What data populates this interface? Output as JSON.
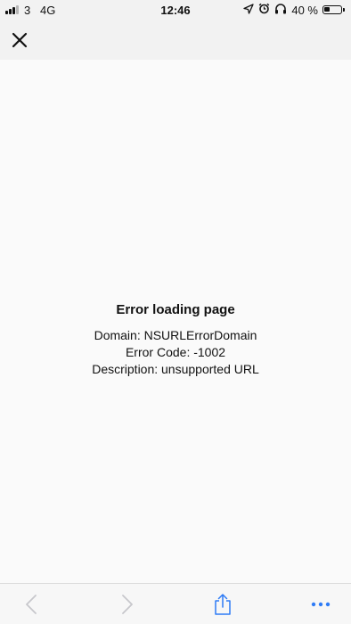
{
  "status_bar": {
    "carrier": "3",
    "network": "4G",
    "time": "12:46",
    "battery_text": "40 %",
    "battery_level": 0.4,
    "signal_bars_filled": 3,
    "signal_bars_total": 4,
    "icons": [
      "location-arrow-icon",
      "alarm-icon",
      "headphones-icon",
      "battery-icon"
    ]
  },
  "toolbar": {
    "close_icon": "close-icon"
  },
  "error": {
    "title": "Error loading page",
    "domain_line": "Domain: NSURLErrorDomain",
    "code_line": "Error Code: -1002",
    "description_line": "Description: unsupported URL"
  },
  "bottom_bar": {
    "icons": [
      "back-arrow-icon",
      "forward-arrow-icon",
      "share-icon",
      "more-icon"
    ]
  },
  "colors": {
    "header_bg": "#f2f2f2",
    "content_bg": "#fafafa",
    "accent": "#2f7cf6",
    "disabled": "#c7c7cc",
    "text": "#111111"
  }
}
